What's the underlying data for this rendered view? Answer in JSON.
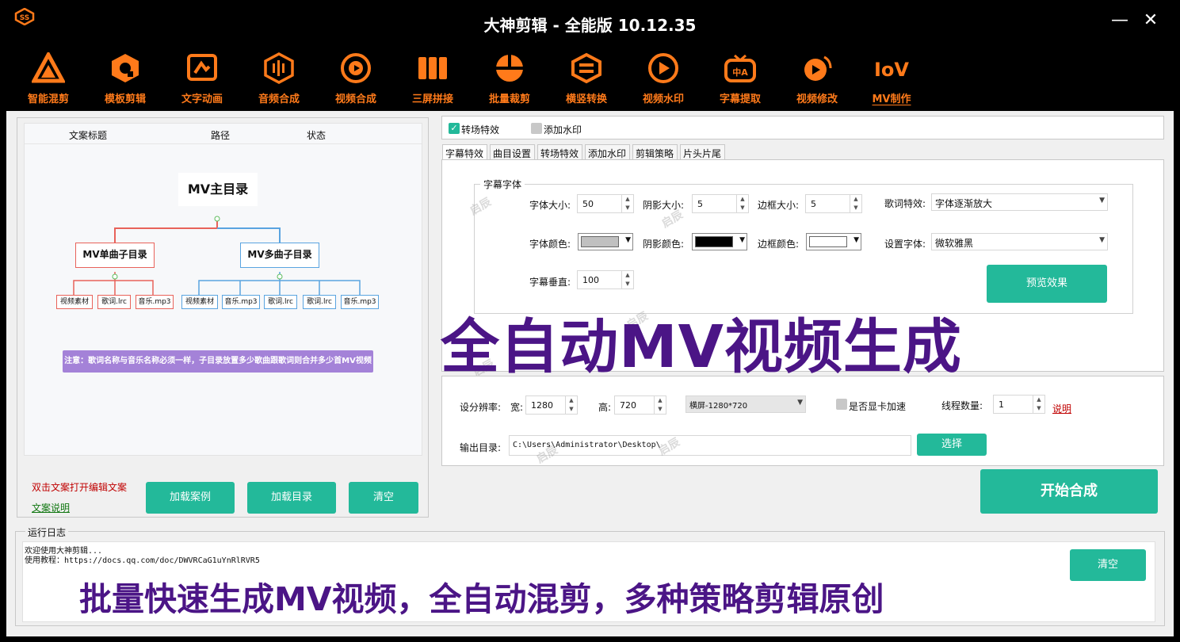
{
  "window": {
    "title": "大神剪辑 - 全能版 10.12.35",
    "minimize_glyph": "—",
    "close_glyph": "✕"
  },
  "colors": {
    "accent_orange": "#ff7a1a",
    "button_green": "#23b99a",
    "overlay_purple": "#4b1586",
    "link_red": "#c00000"
  },
  "toolbar": {
    "items": [
      {
        "label": "智能混剪",
        "icon": "smart-mix-icon"
      },
      {
        "label": "模板剪辑",
        "icon": "template-icon"
      },
      {
        "label": "文字动画",
        "icon": "text-animation-icon"
      },
      {
        "label": "音频合成",
        "icon": "audio-icon"
      },
      {
        "label": "视频合成",
        "icon": "video-compose-icon"
      },
      {
        "label": "三屏拼接",
        "icon": "three-screen-icon"
      },
      {
        "label": "批量裁剪",
        "icon": "batch-crop-icon"
      },
      {
        "label": "横竖转换",
        "icon": "orientation-icon"
      },
      {
        "label": "视频水印",
        "icon": "watermark-icon"
      },
      {
        "label": "字幕提取",
        "icon": "subtitle-icon"
      },
      {
        "label": "视频修改",
        "icon": "video-edit-icon"
      },
      {
        "label": "MV制作",
        "icon": "mv-icon",
        "active": true
      }
    ]
  },
  "left_panel": {
    "columns": [
      "文案标题",
      "路径",
      "状态"
    ],
    "diagram": {
      "root": "MV主目录",
      "left_child": "MV单曲子目录",
      "right_child": "MV多曲子目录",
      "left_leaves": [
        "视频素材",
        "歌词.lrc",
        "音乐.mp3"
      ],
      "right_leaves": [
        "视频素材",
        "音乐.mp3",
        "歌词.lrc",
        "歌词.lrc",
        "音乐.mp3"
      ],
      "note": "注意：歌词名称与音乐名称必须一样，子目录放置多少歌曲跟歌词则合并多少首MV视频"
    },
    "hint": "双击文案打开编辑文案",
    "doc_link": "文案说明",
    "buttons": {
      "load_example": "加载案例",
      "load_dir": "加载目录",
      "clear": "清空"
    }
  },
  "right_panel": {
    "checks": {
      "transition": "转场特效",
      "watermark": "添加水印"
    },
    "tabs": [
      "字幕特效",
      "曲目设置",
      "转场特效",
      "添加水印",
      "剪辑策略",
      "片头片尾"
    ],
    "group_title": "字幕字体",
    "font_size": {
      "label": "字体大小:",
      "value": "50"
    },
    "shadow_size": {
      "label": "阴影大小:",
      "value": "5"
    },
    "border_size": {
      "label": "边框大小:",
      "value": "5"
    },
    "lyric_effect": {
      "label": "歌词特效:",
      "value": "字体逐渐放大"
    },
    "font_color": {
      "label": "字体颜色:",
      "value": "#c0c0c0"
    },
    "shadow_color": {
      "label": "阴影颜色:",
      "value": "#000000"
    },
    "border_color": {
      "label": "边框颜色:",
      "value": "#ffffff"
    },
    "font_family": {
      "label": "设置字体:",
      "value": "微软雅黑"
    },
    "vertical": {
      "label": "字幕垂直:",
      "value": "100"
    },
    "preview_button": "预览效果",
    "resolution": {
      "label": "设分辨率:",
      "width_label": "宽:",
      "width": "1280",
      "height_label": "高:",
      "height": "720",
      "preset": "横屏-1280*720"
    },
    "gpu": "是否显卡加速",
    "threads": {
      "label": "线程数量:",
      "value": "1"
    },
    "help_link": "说明",
    "output": {
      "label": "输出目录:",
      "value": "C:\\Users\\Administrator\\Desktop\\",
      "choose": "选择"
    },
    "start_button": "开始合成"
  },
  "log": {
    "title": "运行日志",
    "line1": "欢迎使用大神剪辑...",
    "line2": "使用教程：https://docs.qq.com/doc/DWVRCaG1uYnRlRVR5",
    "clear": "清空"
  },
  "watermark_text": "启辰",
  "overlays": {
    "headline": "全自动MV视频生成",
    "subline": "批量快速生成MV视频，全自动混剪，多种策略剪辑原创"
  }
}
